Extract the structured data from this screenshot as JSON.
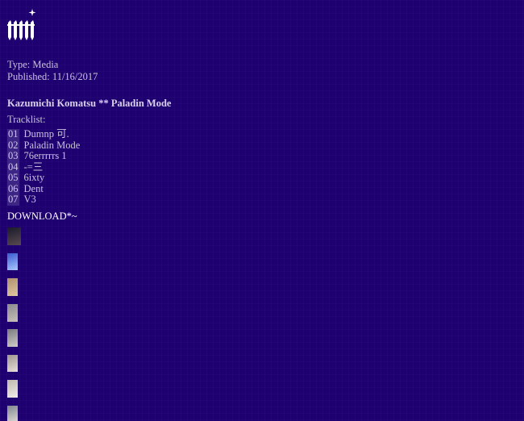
{
  "info": {
    "type_line": "Type: Media",
    "published_line": "Published: 11/16/2017"
  },
  "release": {
    "title": "Kazumichi Komatsu ** Paladin Mode",
    "tracklist_label": "Tracklist:",
    "tracks": [
      {
        "num": "01",
        "title": "Dumnp 可."
      },
      {
        "num": "02",
        "title": "Paladin Mode"
      },
      {
        "num": "03",
        "title": "76errrrrs 1"
      },
      {
        "num": "04",
        "title": "-=三"
      },
      {
        "num": "05",
        "title": "6ixty"
      },
      {
        "num": "06",
        "title": "Dent"
      },
      {
        "num": "07",
        "title": "V3"
      }
    ],
    "download_label": "DOWNLOAD*~"
  },
  "thumbnails": [
    {
      "name": "thumbnail-1",
      "colors": [
        "#1a1a2a",
        "#5a4a50"
      ]
    },
    {
      "name": "thumbnail-2",
      "colors": [
        "#3a5ad0",
        "#a8c8ff"
      ]
    },
    {
      "name": "thumbnail-3",
      "colors": [
        "#b09070",
        "#e0c8a0"
      ]
    },
    {
      "name": "thumbnail-4",
      "colors": [
        "#8a8a90",
        "#c8c0b8"
      ]
    },
    {
      "name": "thumbnail-5",
      "colors": [
        "#7a7a80",
        "#d0ccc8"
      ]
    },
    {
      "name": "thumbnail-6",
      "colors": [
        "#a09890",
        "#e8e0d8"
      ]
    },
    {
      "name": "thumbnail-7",
      "colors": [
        "#c0b8b0",
        "#f0ece8"
      ]
    },
    {
      "name": "thumbnail-8",
      "colors": [
        "#808890",
        "#d8d4d0"
      ]
    }
  ]
}
